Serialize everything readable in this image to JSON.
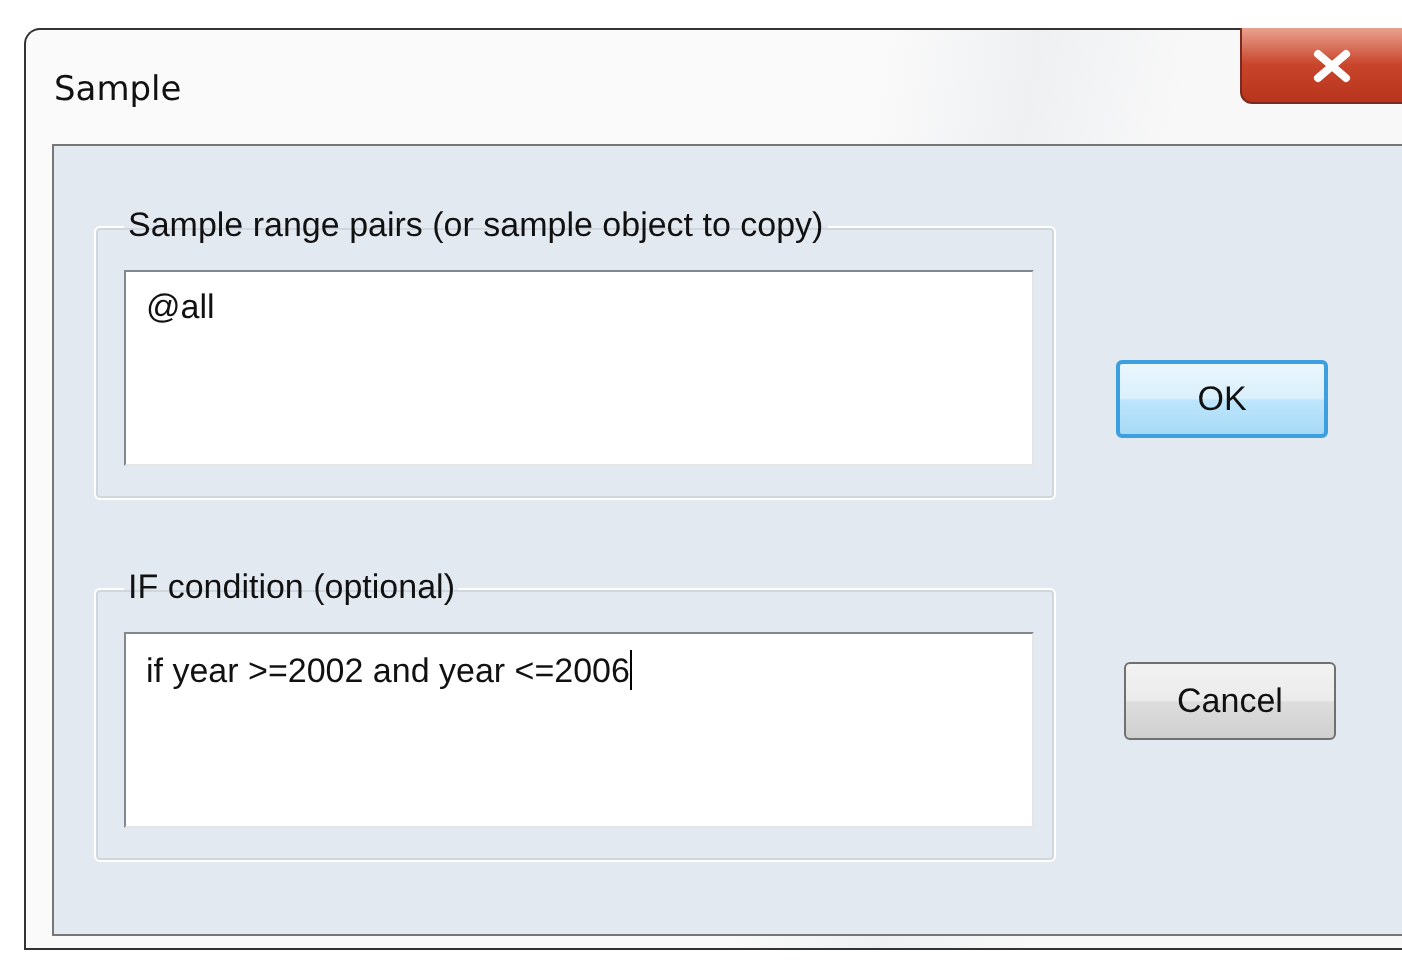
{
  "window": {
    "title": "Sample"
  },
  "groups": [
    {
      "label": "Sample range pairs (or sample object to copy)",
      "value": "@all",
      "focused": false
    },
    {
      "label": "IF condition (optional)",
      "value": "if year >=2002 and year <=2006",
      "focused": true
    }
  ],
  "buttons": [
    {
      "label": "OK",
      "default": true
    },
    {
      "label": "Cancel",
      "default": false
    }
  ]
}
